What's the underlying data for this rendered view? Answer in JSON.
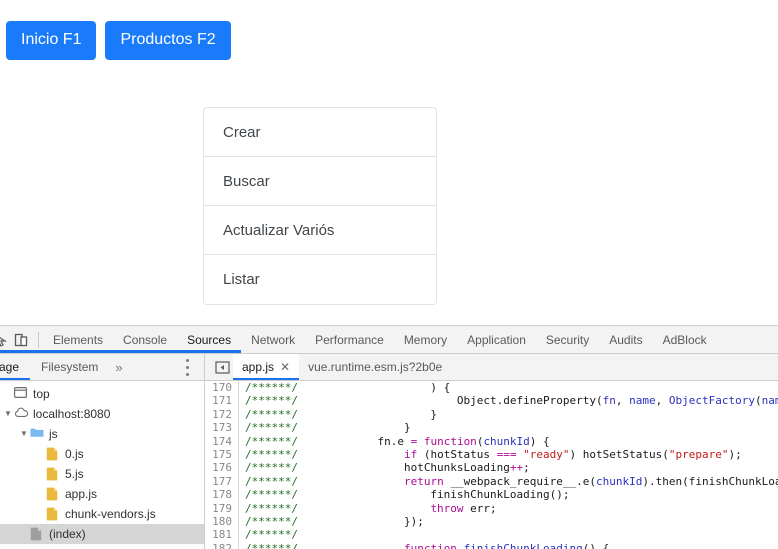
{
  "page": {
    "buttons": [
      {
        "label": "Inicio F1",
        "name": "inicio-button"
      },
      {
        "label": "Productos F2",
        "name": "productos-button"
      }
    ],
    "menu_items": [
      {
        "label": "Crear"
      },
      {
        "label": "Buscar"
      },
      {
        "label": "Actualizar Variós"
      },
      {
        "label": "Listar"
      }
    ],
    "accent_color": "#1a7bfa"
  },
  "devtools": {
    "accent_color": "#1a73e8",
    "icons": {
      "inspect": "inspect-icon",
      "device_toolbar": "device-toolbar-icon",
      "kebab": "more-options-icon",
      "navigator_toggle": "show-navigator-icon"
    },
    "tabs": [
      {
        "label": "Elements",
        "active": false
      },
      {
        "label": "Console",
        "active": false
      },
      {
        "label": "Sources",
        "active": true
      },
      {
        "label": "Network",
        "active": false
      },
      {
        "label": "Performance",
        "active": false
      },
      {
        "label": "Memory",
        "active": false
      },
      {
        "label": "Application",
        "active": false
      },
      {
        "label": "Security",
        "active": false
      },
      {
        "label": "Audits",
        "active": false
      },
      {
        "label": "AdBlock",
        "active": false
      }
    ],
    "navigator": {
      "subtabs": [
        {
          "label": "age",
          "active": true
        },
        {
          "label": "Filesystem",
          "active": false
        }
      ],
      "more_label": "»",
      "tree": [
        {
          "label": "top",
          "icon": "frame-icon",
          "depth": 0,
          "twisty": "",
          "selected": false
        },
        {
          "label": "localhost:8080",
          "icon": "cloud-icon",
          "depth": 0,
          "twisty": "▼",
          "selected": false
        },
        {
          "label": "js",
          "icon": "folder-icon",
          "depth": 1,
          "twisty": "▼",
          "selected": false
        },
        {
          "label": "0.js",
          "icon": "js-file-icon",
          "depth": 2,
          "twisty": "",
          "selected": false
        },
        {
          "label": "5.js",
          "icon": "js-file-icon",
          "depth": 2,
          "twisty": "",
          "selected": false
        },
        {
          "label": "app.js",
          "icon": "js-file-icon",
          "depth": 2,
          "twisty": "",
          "selected": false
        },
        {
          "label": "chunk-vendors.js",
          "icon": "js-file-icon",
          "depth": 2,
          "twisty": "",
          "selected": false
        },
        {
          "label": "(index)",
          "icon": "document-icon",
          "depth": 1,
          "twisty": "",
          "selected": true
        }
      ]
    },
    "file_tabs": [
      {
        "label": "app.js",
        "active": true,
        "closable": true,
        "close_label": "✕"
      },
      {
        "label": "vue.runtime.esm.js?2b0e",
        "active": false,
        "closable": false,
        "close_label": ""
      }
    ],
    "editor": {
      "first_line": 170,
      "gutter_comment": "/******/",
      "lines": [
        {
          "n": "170",
          "tokens": [
            {
              "t": "                    ) {",
              "c": "cm-plain"
            }
          ]
        },
        {
          "n": "171",
          "tokens": [
            {
              "t": "                        Object.defineProperty(",
              "c": "cm-plain"
            },
            {
              "t": "fn",
              "c": "cm-var"
            },
            {
              "t": ", ",
              "c": "cm-plain"
            },
            {
              "t": "name",
              "c": "cm-var"
            },
            {
              "t": ", ",
              "c": "cm-plain"
            },
            {
              "t": "ObjectFactory",
              "c": "cm-var"
            },
            {
              "t": "(",
              "c": "cm-plain"
            },
            {
              "t": "name",
              "c": "cm-var"
            },
            {
              "t": "));",
              "c": "cm-plain"
            }
          ]
        },
        {
          "n": "172",
          "tokens": [
            {
              "t": "                    }",
              "c": "cm-plain"
            }
          ]
        },
        {
          "n": "173",
          "tokens": [
            {
              "t": "                }",
              "c": "cm-plain"
            }
          ]
        },
        {
          "n": "174",
          "tokens": [
            {
              "t": "            fn.e ",
              "c": "cm-plain"
            },
            {
              "t": "= ",
              "c": "cm-kw"
            },
            {
              "t": "function",
              "c": "cm-kw"
            },
            {
              "t": "(",
              "c": "cm-plain"
            },
            {
              "t": "chunkId",
              "c": "cm-var"
            },
            {
              "t": ") {",
              "c": "cm-plain"
            }
          ]
        },
        {
          "n": "175",
          "tokens": [
            {
              "t": "                ",
              "c": "cm-plain"
            },
            {
              "t": "if",
              "c": "cm-kw"
            },
            {
              "t": " (hotStatus ",
              "c": "cm-plain"
            },
            {
              "t": "===",
              "c": "cm-kw"
            },
            {
              "t": " ",
              "c": "cm-plain"
            },
            {
              "t": "\"ready\"",
              "c": "cm-str"
            },
            {
              "t": ") hotSetStatus(",
              "c": "cm-plain"
            },
            {
              "t": "\"prepare\"",
              "c": "cm-str"
            },
            {
              "t": ");",
              "c": "cm-plain"
            }
          ]
        },
        {
          "n": "176",
          "tokens": [
            {
              "t": "                hotChunksLoading",
              "c": "cm-plain"
            },
            {
              "t": "++",
              "c": "cm-kw"
            },
            {
              "t": ";",
              "c": "cm-plain"
            }
          ]
        },
        {
          "n": "177",
          "tokens": [
            {
              "t": "                ",
              "c": "cm-plain"
            },
            {
              "t": "return",
              "c": "cm-kw"
            },
            {
              "t": " __webpack_require__.e(",
              "c": "cm-plain"
            },
            {
              "t": "chunkId",
              "c": "cm-var"
            },
            {
              "t": ").then(finishChunkLoading,",
              "c": "cm-plain"
            }
          ]
        },
        {
          "n": "178",
          "tokens": [
            {
              "t": "                    finishChunkLoading();",
              "c": "cm-plain"
            }
          ]
        },
        {
          "n": "179",
          "tokens": [
            {
              "t": "                    ",
              "c": "cm-plain"
            },
            {
              "t": "throw",
              "c": "cm-kw"
            },
            {
              "t": " err;",
              "c": "cm-plain"
            }
          ]
        },
        {
          "n": "180",
          "tokens": [
            {
              "t": "                });",
              "c": "cm-plain"
            }
          ]
        },
        {
          "n": "181",
          "tokens": [
            {
              "t": "",
              "c": "cm-plain"
            }
          ]
        },
        {
          "n": "182",
          "tokens": [
            {
              "t": "                ",
              "c": "cm-plain"
            },
            {
              "t": "function",
              "c": "cm-kw"
            },
            {
              "t": " ",
              "c": "cm-plain"
            },
            {
              "t": "finishChunkLoading",
              "c": "cm-def"
            },
            {
              "t": "() {",
              "c": "cm-plain"
            }
          ]
        }
      ]
    }
  }
}
